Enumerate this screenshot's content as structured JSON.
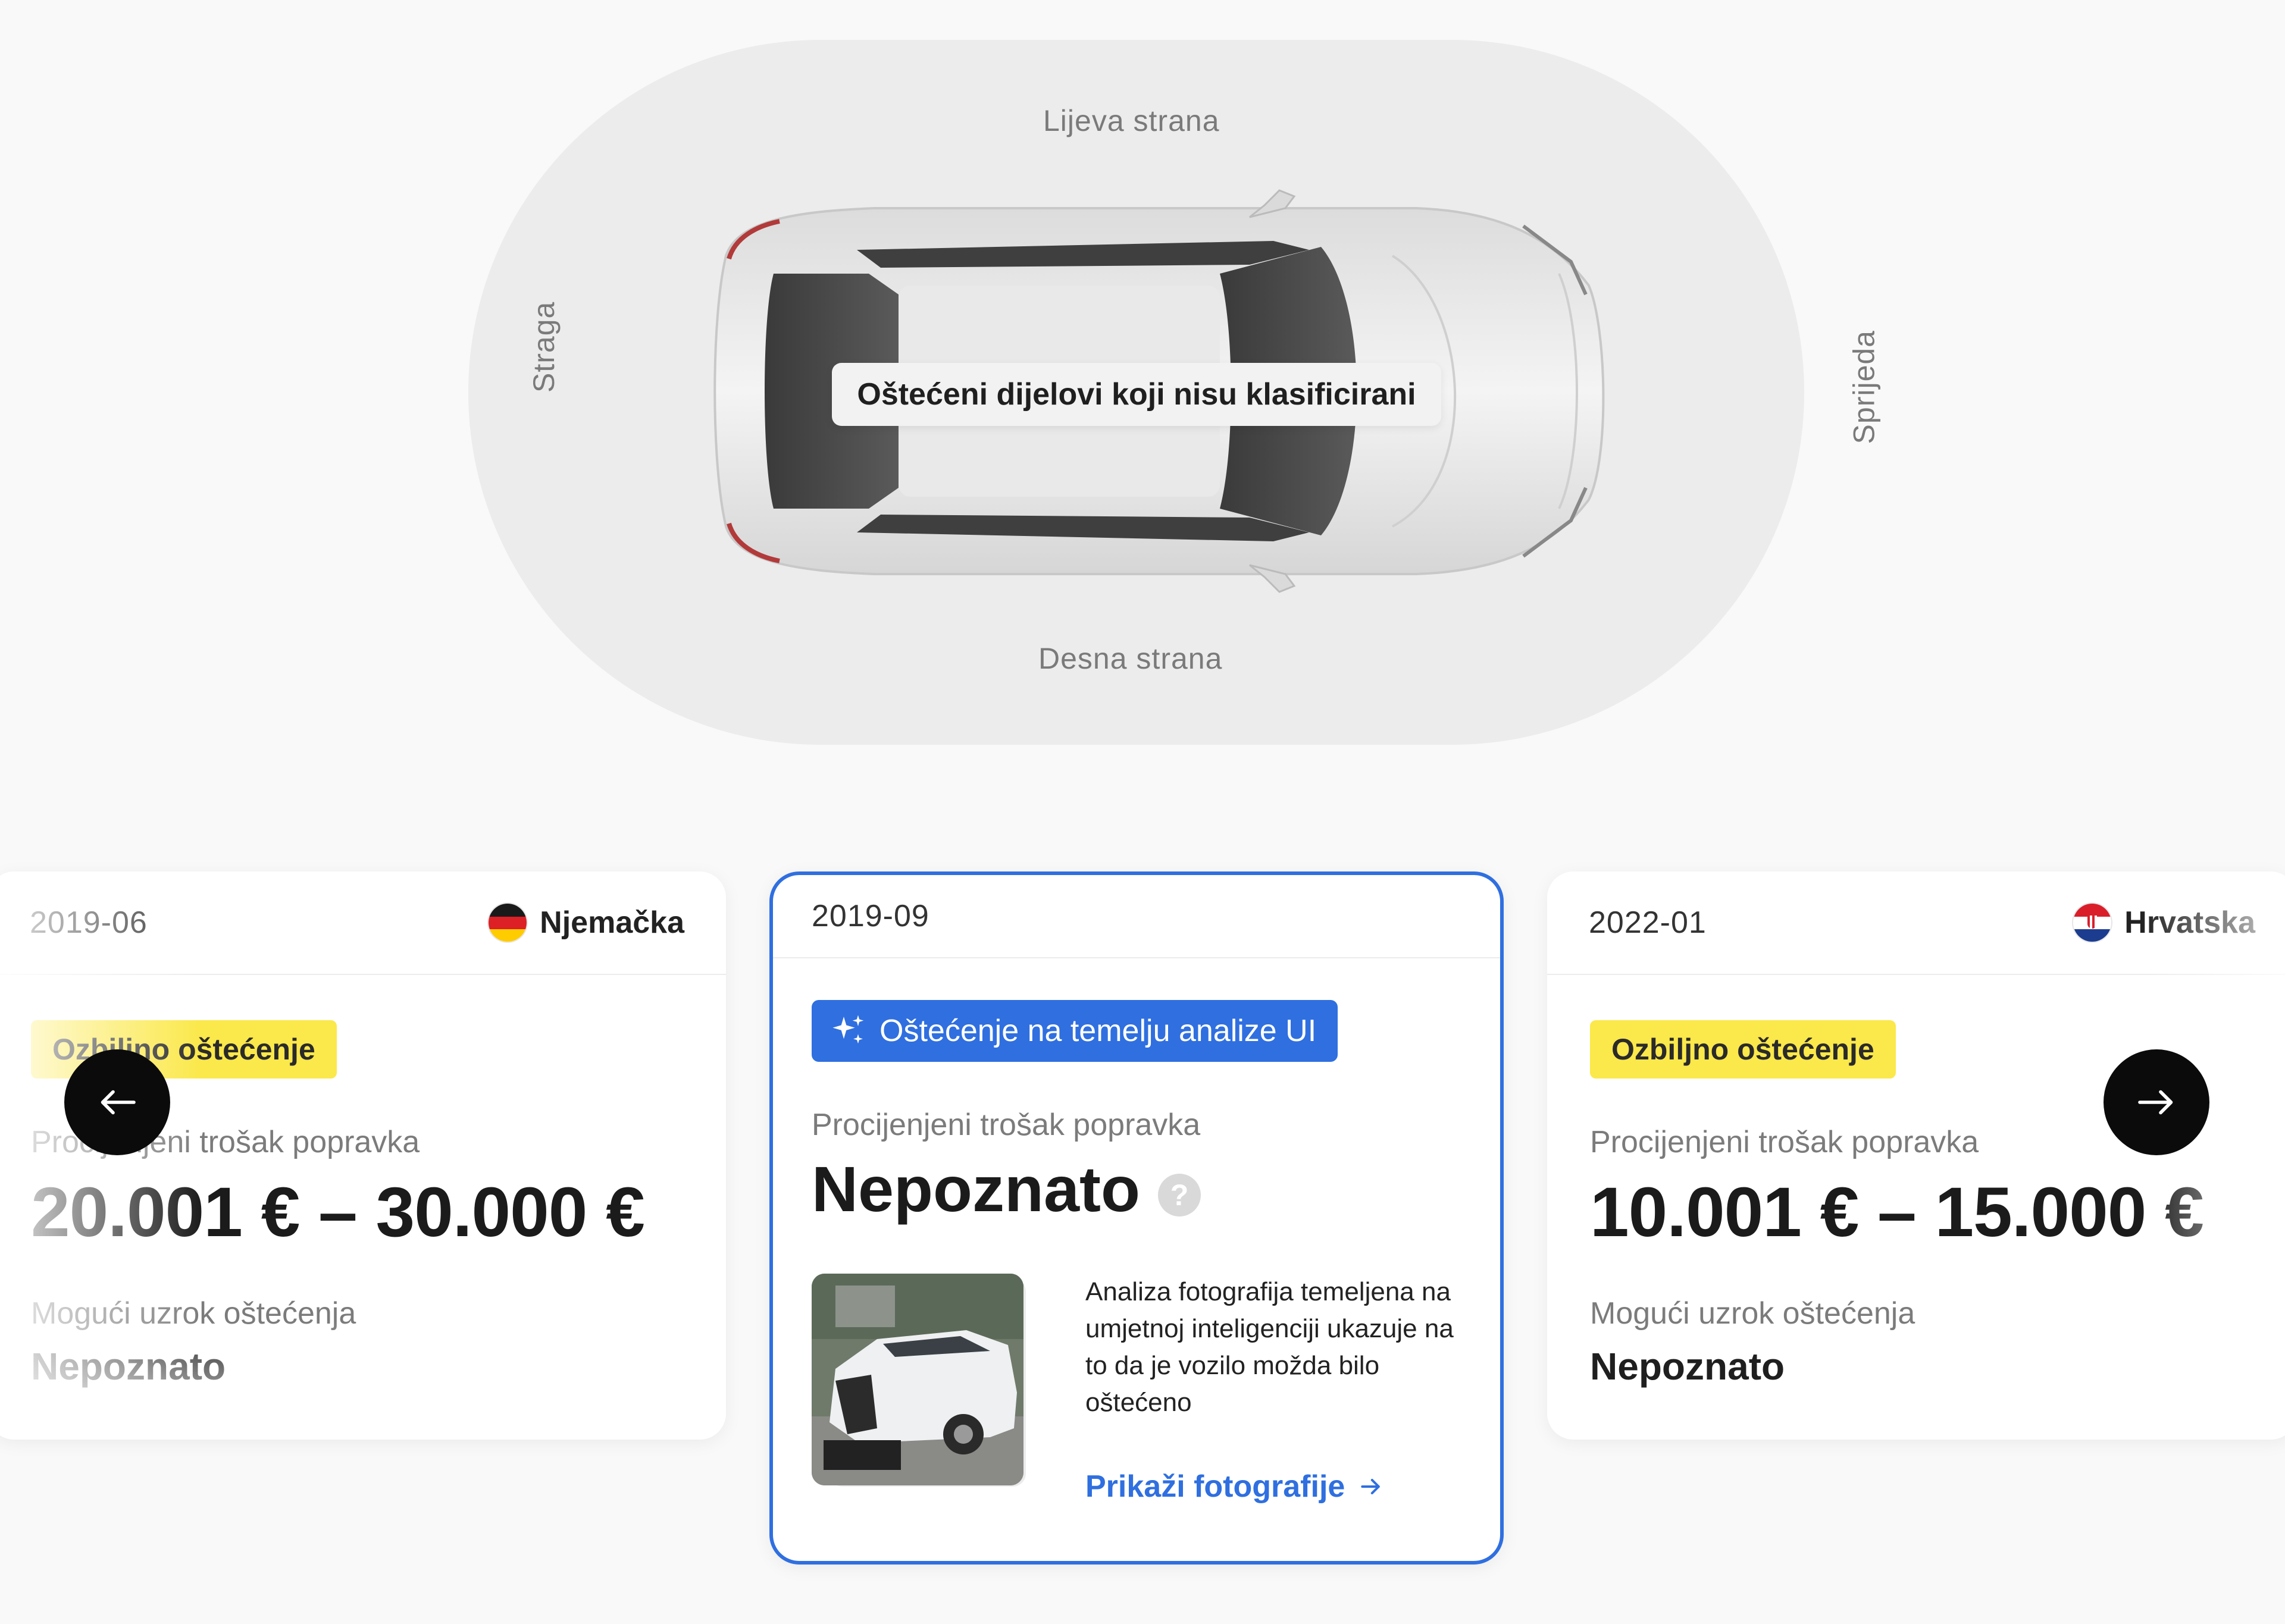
{
  "diagram": {
    "labels": {
      "left_side": "Lijeva strana",
      "right_side": "Desna strana",
      "rear": "Straga",
      "front": "Sprijeda"
    },
    "tooltip": "Oštećeni dijelovi koji nisu klasificirani"
  },
  "cards": [
    {
      "date": "2019-06",
      "country": "Njemačka",
      "flag": "germany-flag",
      "severity": "Ozbiljno oštećenje",
      "cost_label": "Procijenjeni trošak popravka",
      "cost": "20.001 € – 30.000 €",
      "cause_label": "Mogući uzrok oštećenja",
      "cause": "Nepoznato"
    },
    {
      "date": "2019-09",
      "ai_badge": "Oštećenje na temelju analize UI",
      "cost_label": "Procijenjeni trošak popravka",
      "cost": "Nepoznato",
      "help_icon": "?",
      "ai_text": "Analiza fotografija temeljena na umjetnoj inteligenciji ukazuje na to da je vozilo možda bilo oštećeno",
      "show_photos": "Prikaži fotografije"
    },
    {
      "date": "2022-01",
      "country": "Hrvatska",
      "flag": "croatia-flag",
      "severity": "Ozbiljno oštećenje",
      "cost_label": "Procijenjeni trošak popravka",
      "cost": "10.001 € – 15.000 €",
      "cause_label": "Mogući uzrok oštećenja",
      "cause": "Nepoznato"
    }
  ],
  "nav": {
    "prev_icon": "arrow-left-icon",
    "next_icon": "arrow-right-icon"
  },
  "colors": {
    "accent_blue": "#2f6fe0",
    "severity_yellow": "#fbe84a",
    "diagram_bg": "#ececec",
    "page_bg": "#f9f9f9"
  }
}
